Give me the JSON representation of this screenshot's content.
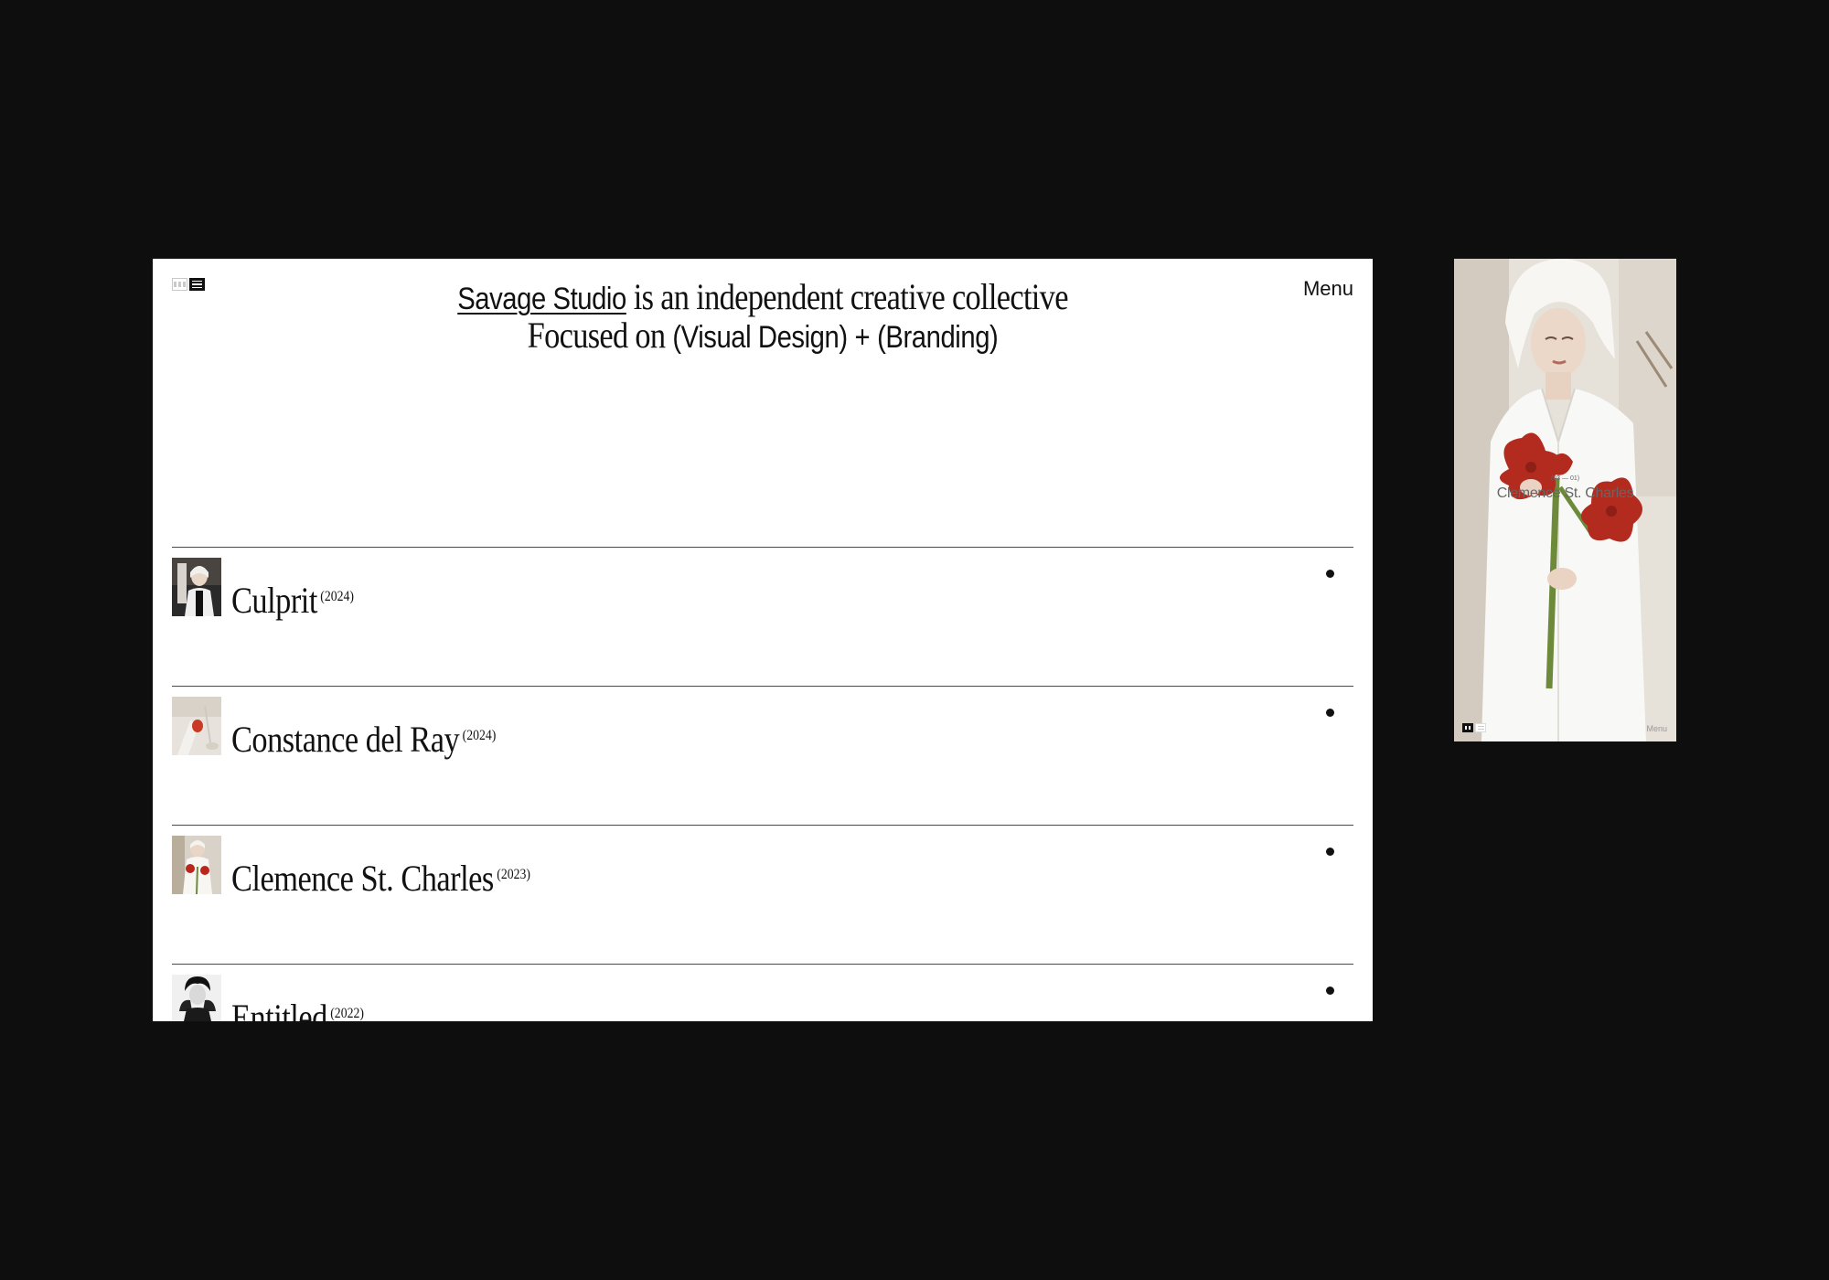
{
  "desktop": {
    "headline": {
      "studio_link": "Savage Studio",
      "line1_rest": "is an independent creative collective",
      "line2_prefix": "Focused on",
      "focus_1": "(Visual Design)",
      "joiner": "+",
      "focus_2": "(Branding)"
    },
    "menu_label": "Menu",
    "projects": [
      {
        "title": "Culprit",
        "year": "(2024)"
      },
      {
        "title": "Constance del Ray",
        "year": "(2024)"
      },
      {
        "title": "Clemence St. Charles",
        "year": "(2023)"
      },
      {
        "title": "Entitled",
        "year": "(2022)"
      }
    ]
  },
  "mobile": {
    "index": "(03 — 01)",
    "caption": "Clemence St. Charles",
    "menu_label": "Menu"
  },
  "colors": {
    "background": "#0e0e0e",
    "page": "#ffffff",
    "text": "#111111",
    "rose_red": "#b32a1f"
  },
  "icons": [
    "grid-view-icon",
    "list-view-icon",
    "bullet-dot-icon"
  ]
}
